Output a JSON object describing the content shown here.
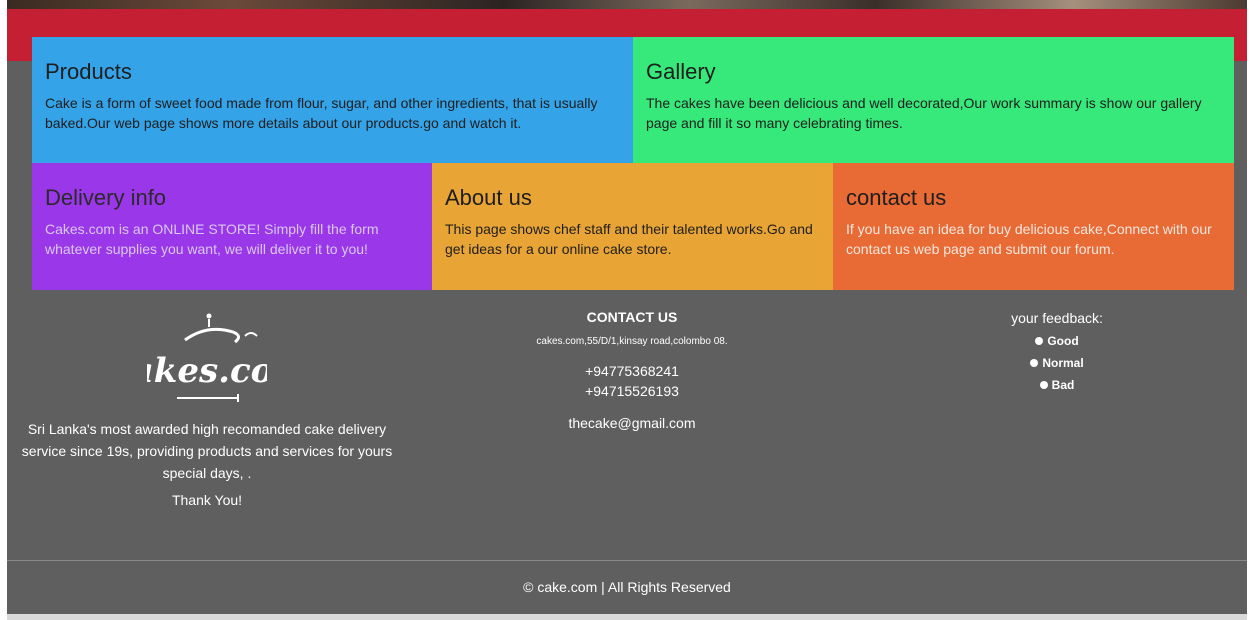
{
  "colors": {
    "page_bg": "#5f5f5f",
    "red_band": "#c51f33",
    "products": "#35a3e8",
    "gallery": "#37e87a",
    "delivery": "#9a37e8",
    "about": "#e8a435",
    "contact": "#e86a35"
  },
  "cards": {
    "products": {
      "title": "Products",
      "text": "Cake is a form of sweet food made from flour, sugar, and other ingredients, that is usually baked.Our web page shows more details about our products.go and watch it."
    },
    "gallery": {
      "title": "Gallery",
      "text": "The cakes have been delicious and well decorated,Our work summary is show our gallery page and fill it so many celebrating times."
    },
    "delivery": {
      "title": "Delivery info",
      "text": "Cakes.com is an ONLINE STORE! Simply fill the form whatever supplies you want, we will deliver it to you!"
    },
    "about": {
      "title": "About us",
      "text": "This page shows chef staff and their talented works.Go and get ideas for a our online cake store."
    },
    "contact": {
      "title": "contact us",
      "text": "If you have an idea for buy delicious cake,Connect with our contact us web page and submit our forum."
    }
  },
  "footer": {
    "logo_text": "Cakes.com",
    "about_text": "Sri Lanka's most awarded high recomanded cake delivery service since 19s, providing products and services for yours special days, .",
    "thanks": "Thank You!",
    "contact_title": "CONTACT US",
    "address": "cakes.com,55/D/1,kinsay road,colombo 08.",
    "phone1": "+94775368241",
    "phone2": "+94715526193",
    "email": "thecake@gmail.com",
    "feedback_title": "your feedback:",
    "feedback_options": [
      "Good",
      "Normal",
      "Bad"
    ],
    "copyright": "© cake.com | All Rights Reserved"
  }
}
